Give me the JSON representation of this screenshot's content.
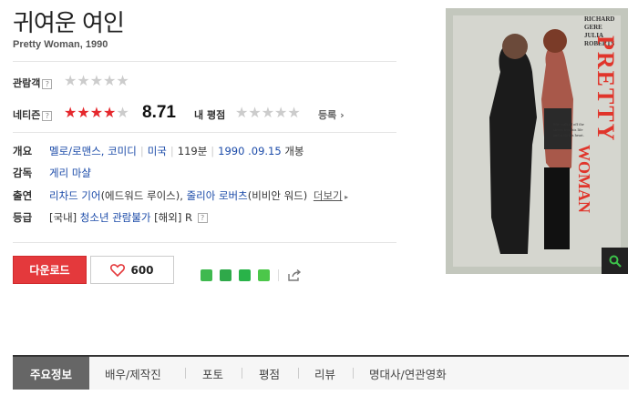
{
  "movie": {
    "title": "귀여운 여인",
    "subtitle": "Pretty Woman, 1990"
  },
  "ratings": {
    "audience_label": "관람객",
    "audience_stars": 0,
    "netizen_label": "네티즌",
    "netizen_stars": 4.35,
    "netizen_score": "8.71",
    "my_rating_label": "내 평점",
    "my_rating_stars": 0,
    "register_label": "등록",
    "help_glyph": "?"
  },
  "info": {
    "overview_label": "개요",
    "genre_1": "멜로/로맨스",
    "genre_sep": ", ",
    "genre_2": "코미디",
    "country": "미국",
    "runtime": "119분",
    "release_date": "1990 .09.15",
    "release_suffix": " 개봉",
    "director_label": "감독",
    "director": "게리 마샬",
    "cast_label": "출연",
    "cast_1": "리차드 기어",
    "cast_1_role": "(에드워드 루이스), ",
    "cast_2": "줄리아 로버츠",
    "cast_2_role": "(비비안 워드)",
    "more_label": "더보기",
    "grade_label": "등급",
    "grade_domestic_prefix": "[국내] ",
    "grade_domestic": "청소년 관람불가",
    "grade_foreign": " [해외] R"
  },
  "actions": {
    "download_label": "다운로드",
    "like_count": "600"
  },
  "share": {
    "icons": [
      "blog-icon",
      "cafe-icon",
      "band-icon",
      "line-icon"
    ],
    "colors": [
      "#3fb94f",
      "#2fa94a",
      "#29b349",
      "#4cc74a"
    ]
  },
  "poster": {
    "top_credits_1": "RICHARD GERE",
    "top_credits_2": "JULIA ROBERTS",
    "title_word_1": "PRETTY",
    "title_word_2": "WOMAN",
    "tagline": "She walked off the street, into his life and stole his heart."
  },
  "tabs": [
    "주요정보",
    "배우/제작진",
    "포토",
    "평점",
    "리뷰",
    "명대사/연관영화"
  ],
  "colors": {
    "accent": "#e4393c",
    "link": "#1a4aa8"
  }
}
